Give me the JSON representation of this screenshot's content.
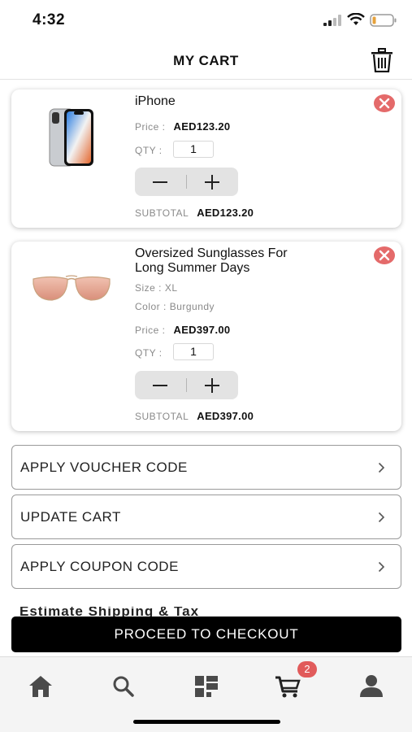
{
  "status_bar": {
    "time": "4:32"
  },
  "header": {
    "title": "MY CART"
  },
  "cart": {
    "items": [
      {
        "name": "iPhone",
        "price_label": "Price :",
        "price": "AED123.20",
        "qty_label": "QTY :",
        "qty": "1",
        "subtotal_label": "SUBTOTAL",
        "subtotal": "AED123.20",
        "image": "iphone-image"
      },
      {
        "name_line1": "Oversized Sunglasses For",
        "name_line2": "Long Summer Days",
        "size_label": "Size :",
        "size": "XL",
        "color_label": "Color :",
        "color": "Burgundy",
        "price_label": "Price :",
        "price": "AED397.00",
        "qty_label": "QTY :",
        "qty": "1",
        "subtotal_label": "SUBTOTAL",
        "subtotal": "AED397.00",
        "image": "sunglasses-image"
      }
    ]
  },
  "options": [
    {
      "label": "APPLY VOUCHER CODE"
    },
    {
      "label": "UPDATE CART"
    },
    {
      "label": "APPLY COUPON CODE"
    }
  ],
  "partial_row": {
    "label": "Estimate Shipping & Tax"
  },
  "checkout": {
    "label": "PROCEED TO CHECKOUT"
  },
  "tabbar": {
    "tabs": [
      "home-icon",
      "search-icon",
      "categories-icon",
      "cart-icon",
      "account-icon"
    ],
    "cart_badge": "2"
  },
  "colors": {
    "remove_button": "#e46a6a",
    "badge": "#e15b5b",
    "checkout_bg": "#000000",
    "stepper_bg": "#e3e3e3"
  }
}
